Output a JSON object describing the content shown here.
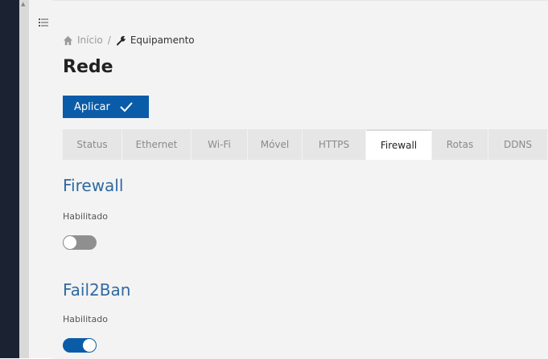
{
  "breadcrumb": {
    "home_icon": "home-icon",
    "home_label": "Início",
    "separator": "/",
    "current_icon": "wrench-icon",
    "current_label": "Equipamento"
  },
  "page": {
    "title": "Rede"
  },
  "actions": {
    "apply_label": "Aplicar",
    "apply_icon": "check-icon"
  },
  "tabs": [
    {
      "label": "Status"
    },
    {
      "label": "Ethernet"
    },
    {
      "label": "Wi-Fi"
    },
    {
      "label": "Móvel"
    },
    {
      "label": "HTTPS"
    },
    {
      "label": "Firewall",
      "active": true
    },
    {
      "label": "Rotas"
    },
    {
      "label": "DDNS"
    }
  ],
  "sections": [
    {
      "title": "Firewall",
      "field_label": "Habilitado",
      "enabled": false
    },
    {
      "title": "Fail2Ban",
      "field_label": "Habilitado",
      "enabled": true
    }
  ],
  "colors": {
    "accent": "#0a5ca8",
    "section_title": "#2f6aa0",
    "sidebar": "#1b2231"
  }
}
